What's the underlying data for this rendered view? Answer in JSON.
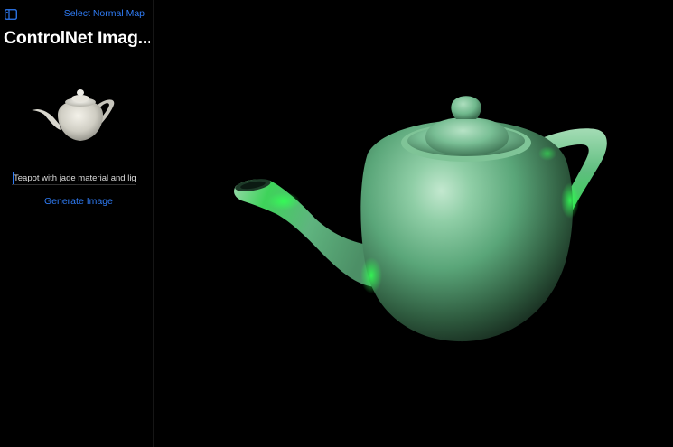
{
  "header": {
    "select_normal_map_label": "Select Normal Map",
    "sidebar_toggle_icon": "sidebar-icon",
    "title": "ControlNet Imag..."
  },
  "sidebar": {
    "thumbnail_icon": "teapot-thumbnail",
    "prompt": {
      "value": "Teapot with jade material and lighting"
    },
    "generate_label": "Generate Image"
  },
  "main": {
    "generated_image_icon": "jade-teapot-image"
  },
  "colors": {
    "accent": "#2f7cf6",
    "background": "#000000",
    "jade": "#5fae7f",
    "jade_glow": "#27e33f"
  }
}
